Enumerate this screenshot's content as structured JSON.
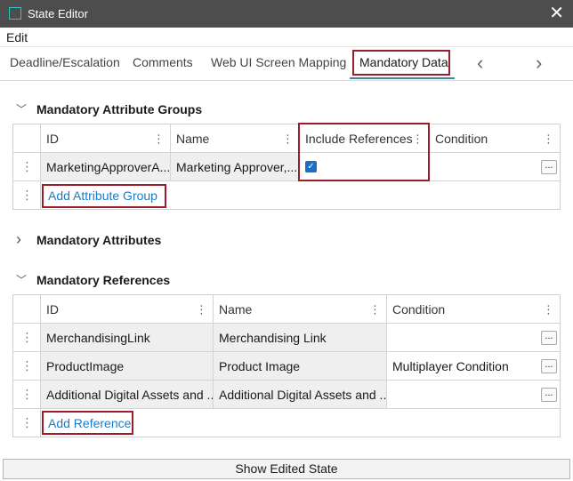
{
  "window": {
    "title": "State Editor",
    "close_glyph": "✕"
  },
  "menu": {
    "edit": "Edit"
  },
  "tabs": {
    "items": [
      "Deadline/Escalation",
      "Comments",
      "Web UI Screen Mapping"
    ],
    "active": "Mandatory Data",
    "prev_glyph": "‹",
    "next_glyph": "›"
  },
  "groups": {
    "title": "Mandatory Attribute Groups",
    "columns": [
      "ID",
      "Name",
      "Include References",
      "Condition"
    ],
    "rows": [
      {
        "id": "MarketingApproverA...",
        "name": "Marketing Approver,...",
        "include_references": true,
        "condition": ""
      }
    ],
    "add_label": "Add Attribute Group"
  },
  "attributes": {
    "title": "Mandatory Attributes"
  },
  "references": {
    "title": "Mandatory References",
    "columns": [
      "ID",
      "Name",
      "Condition"
    ],
    "rows": [
      {
        "id": "MerchandisingLink",
        "name": "Merchandising Link",
        "condition": ""
      },
      {
        "id": "ProductImage",
        "name": "Product Image",
        "condition": "Multiplayer Condition"
      },
      {
        "id": "Additional Digital Assets and ...",
        "name": "Additional Digital Assets and ...",
        "condition": ""
      }
    ],
    "add_label": "Add Reference"
  },
  "footer": {
    "show_edited_state": "Show Edited State"
  },
  "icons": {
    "chevron_down": "﹀",
    "chevron_right": "›",
    "kebab": "⋮",
    "ellipsis": "..."
  },
  "colors": {
    "titlebar": "#4d4d4d",
    "highlight": "#9b1c2a",
    "link": "#1c7ac8",
    "checkbox": "#1a6fc9",
    "tab_underline": "#3a8a98"
  }
}
